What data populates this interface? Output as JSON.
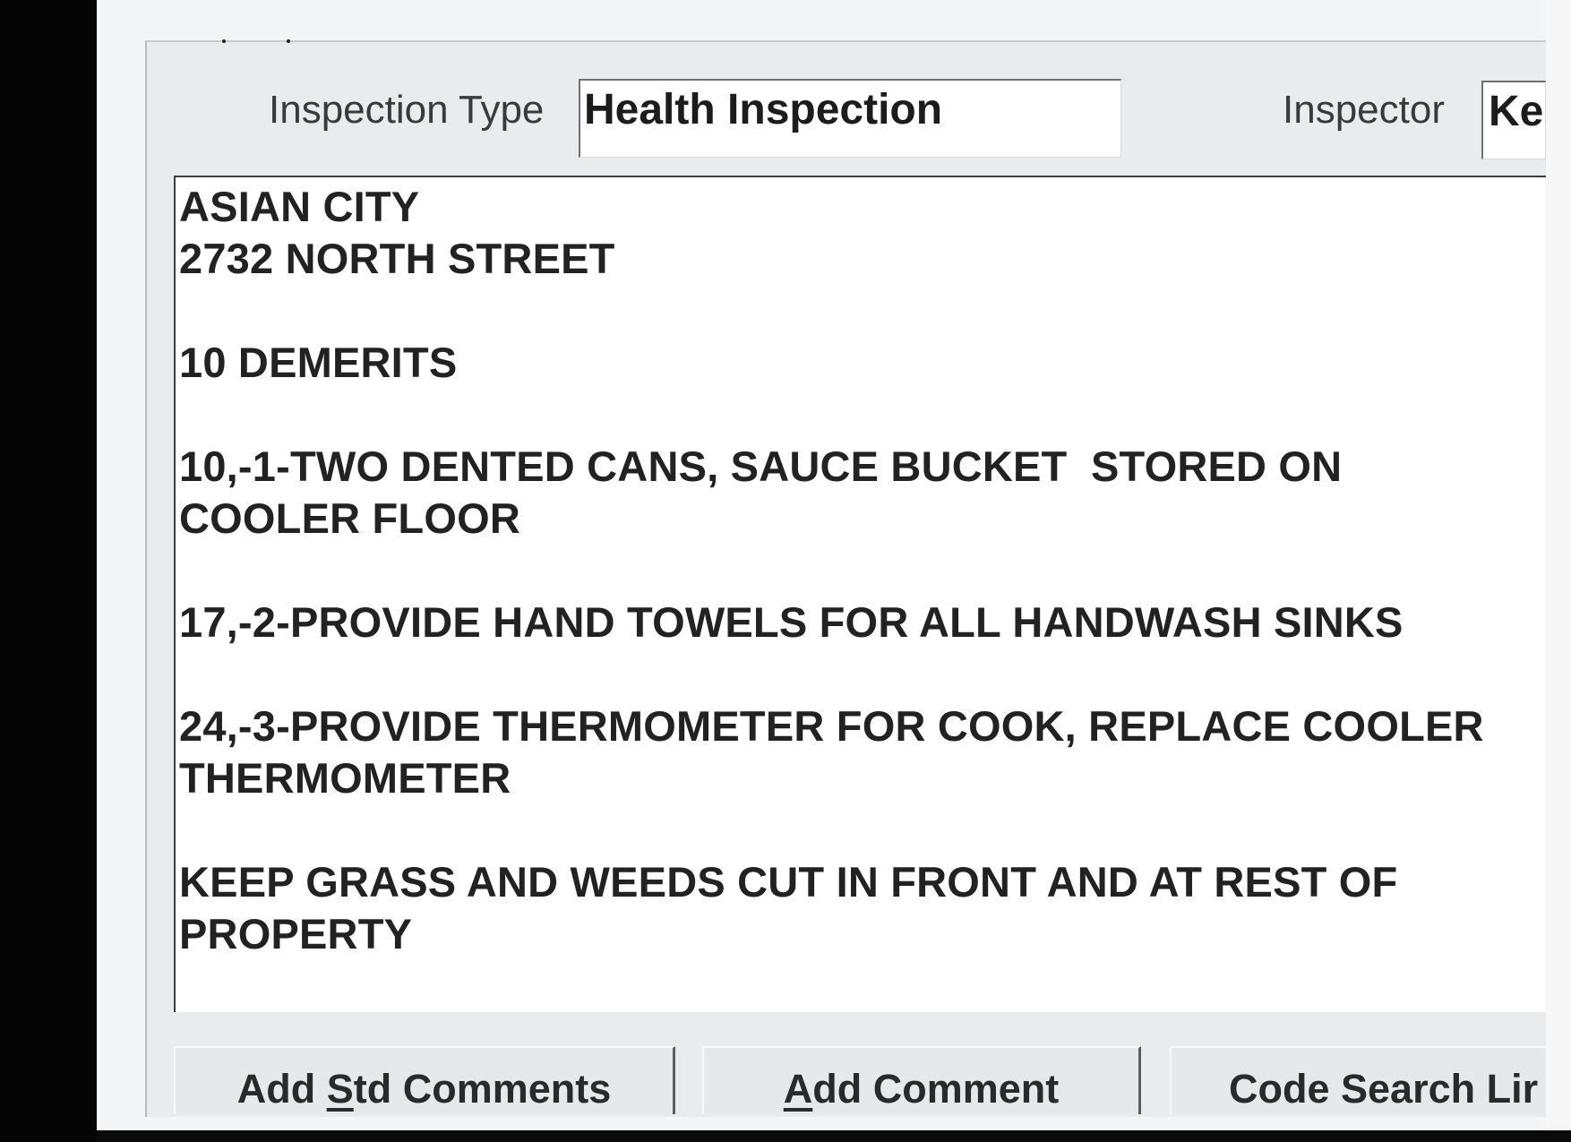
{
  "form": {
    "inspection_type_label": "Inspection Type",
    "inspection_type_value": "Health Inspection",
    "inspector_label": "Inspector",
    "inspector_value": "Ke"
  },
  "comments": {
    "lines": [
      "ASIAN CITY",
      "2732 NORTH STREET",
      "",
      "10 DEMERITS",
      "",
      "10,-1-TWO DENTED CANS, SAUCE BUCKET  STORED ON",
      "COOLER FLOOR",
      "",
      "17,-2-PROVIDE HAND TOWELS FOR ALL HANDWASH SINKS",
      "",
      "24,-3-PROVIDE THERMOMETER FOR COOK, REPLACE COOLER",
      "THERMOMETER",
      "",
      "KEEP GRASS AND WEEDS CUT IN FRONT AND AT REST OF",
      "PROPERTY"
    ]
  },
  "buttons": {
    "add_std_comments": {
      "pre": "Add ",
      "mnemonic": "S",
      "post": "td Comments"
    },
    "add_comment": {
      "pre": "",
      "mnemonic": "A",
      "post": "dd Comment"
    },
    "code_search": {
      "label": "Code Search Lir"
    }
  }
}
